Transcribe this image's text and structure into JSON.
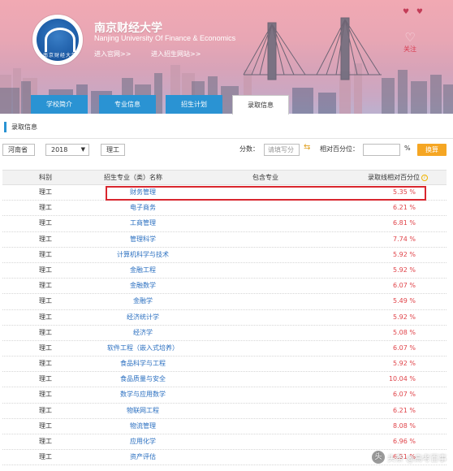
{
  "header": {
    "name_cn": "南京财经大学",
    "name_en": "Nanjing University Of Finance & Economics",
    "logo_text": "南京财经大学",
    "link_official": "进入官网>>",
    "link_admission": "进入招生网站>>",
    "follow_label": "关注"
  },
  "tabs": [
    {
      "label": "学校简介"
    },
    {
      "label": "专业信息"
    },
    {
      "label": "招生计划"
    },
    {
      "label": "录取信息"
    }
  ],
  "section_title": "录取信息",
  "filters": {
    "province": "河南省",
    "year": "2018",
    "subject": "理工",
    "score_label": "分数：",
    "score_placeholder": "请填写分",
    "pct_label": "相对百分位：",
    "pct_value": "",
    "pct_sign": "%",
    "convert_button": "换算"
  },
  "table": {
    "headers": {
      "category": "科别",
      "major": "招生专业（类）名称",
      "includes": "包含专业",
      "pct": "录取线相对百分位"
    },
    "rows": [
      {
        "category": "理工",
        "major": "财务管理",
        "includes": "",
        "pct": "5.35 %"
      },
      {
        "category": "理工",
        "major": "电子商务",
        "includes": "",
        "pct": "6.21 %"
      },
      {
        "category": "理工",
        "major": "工商管理",
        "includes": "",
        "pct": "6.81 %"
      },
      {
        "category": "理工",
        "major": "管理科学",
        "includes": "",
        "pct": "7.74 %"
      },
      {
        "category": "理工",
        "major": "计算机科学与技术",
        "includes": "",
        "pct": "5.92 %"
      },
      {
        "category": "理工",
        "major": "金融工程",
        "includes": "",
        "pct": "5.92 %"
      },
      {
        "category": "理工",
        "major": "金融数学",
        "includes": "",
        "pct": "6.07 %"
      },
      {
        "category": "理工",
        "major": "金融学",
        "includes": "",
        "pct": "5.49 %"
      },
      {
        "category": "理工",
        "major": "经济统计学",
        "includes": "",
        "pct": "5.92 %"
      },
      {
        "category": "理工",
        "major": "经济学",
        "includes": "",
        "pct": "5.08 %"
      },
      {
        "category": "理工",
        "major": "软件工程（嵌入式培养）",
        "includes": "",
        "pct": "6.07 %"
      },
      {
        "category": "理工",
        "major": "食品科学与工程",
        "includes": "",
        "pct": "5.92 %"
      },
      {
        "category": "理工",
        "major": "食品质量与安全",
        "includes": "",
        "pct": "10.04 %"
      },
      {
        "category": "理工",
        "major": "数学与应用数学",
        "includes": "",
        "pct": "6.07 %"
      },
      {
        "category": "理工",
        "major": "物联网工程",
        "includes": "",
        "pct": "6.21 %"
      },
      {
        "category": "理工",
        "major": "物流管理",
        "includes": "",
        "pct": "8.08 %"
      },
      {
        "category": "理工",
        "major": "应用化学",
        "includes": "",
        "pct": "6.96 %"
      },
      {
        "category": "理工",
        "major": "资产评估",
        "includes": "",
        "pct": "6.51 %"
      }
    ]
  },
  "watermark": "头条 @高考百事"
}
